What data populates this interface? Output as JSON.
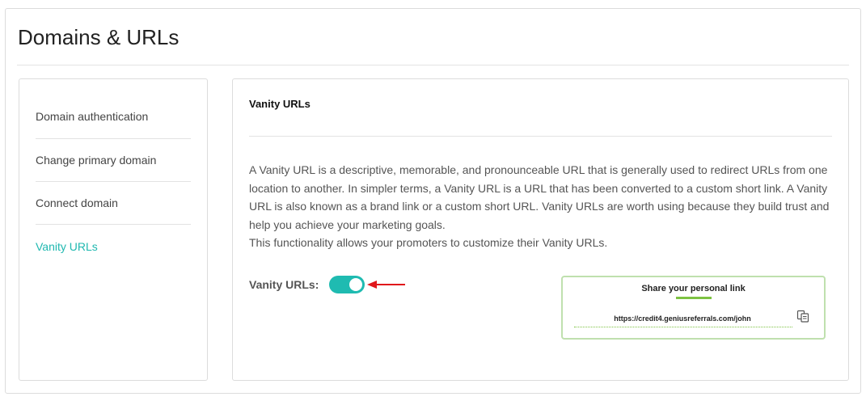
{
  "page": {
    "title": "Domains & URLs"
  },
  "sidebar": {
    "items": [
      {
        "label": "Domain authentication",
        "active": false
      },
      {
        "label": "Change primary domain",
        "active": false
      },
      {
        "label": "Connect domain",
        "active": false
      },
      {
        "label": "Vanity URLs",
        "active": true
      }
    ]
  },
  "main": {
    "section_title": "Vanity URLs",
    "description": [
      "A Vanity URL is a descriptive, memorable, and pronounceable URL that is generally used to redirect URLs from one location to another. In simpler terms, a Vanity URL is a URL that has been converted to a custom short link. A Vanity URL is also known as a brand link or a custom short URL. Vanity URLs are worth using because they build trust and help you achieve your marketing goals.",
      "This functionality allows your promoters to customize their Vanity URLs."
    ],
    "toggle": {
      "label": "Vanity URLs:",
      "enabled": true
    },
    "share_preview": {
      "title": "Share your personal link",
      "url": "https://credit4.geniusreferrals.com/john",
      "icon": "copy-icon"
    }
  },
  "colors": {
    "accent": "#1fbbb1",
    "active_link": "#1fb8b0",
    "arrow": "#e0161b",
    "preview_border": "#bfe0ae",
    "preview_accent": "#7dc242"
  }
}
